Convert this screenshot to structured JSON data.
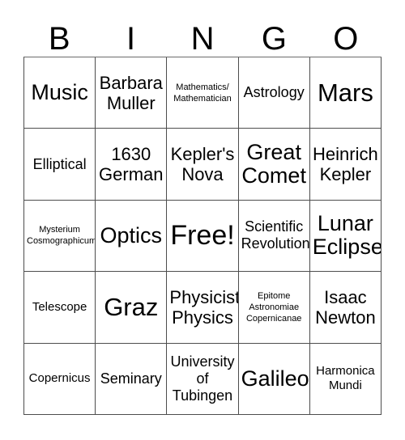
{
  "card": {
    "title_letters": [
      "B",
      "I",
      "N",
      "G",
      "O"
    ],
    "free_space_label": "Free!",
    "border_color": "#4d4d4d",
    "text_color": "#000000",
    "background_color": "#ffffff",
    "rows": [
      [
        {
          "text": "Music",
          "size": "l"
        },
        {
          "text": "Barbara\nMuller",
          "size": "m"
        },
        {
          "text": "Mathematics/\nMathematician",
          "size": "xxs"
        },
        {
          "text": "Astrology",
          "size": "s"
        },
        {
          "text": "Mars",
          "size": "xl"
        }
      ],
      [
        {
          "text": "Elliptical",
          "size": "s"
        },
        {
          "text": "1630\nGerman",
          "size": "m"
        },
        {
          "text": "Kepler's\nNova",
          "size": "m"
        },
        {
          "text": "Great\nComet",
          "size": "l"
        },
        {
          "text": "Heinrich\nKepler",
          "size": "m"
        }
      ],
      [
        {
          "text": "Mysterium\nCosmographicum",
          "size": "xxs"
        },
        {
          "text": "Optics",
          "size": "l"
        },
        {
          "text": "Free!",
          "size": "xxl"
        },
        {
          "text": "Scientific\nRevolution",
          "size": "s"
        },
        {
          "text": "Lunar\nEclipse",
          "size": "l"
        }
      ],
      [
        {
          "text": "Telescope",
          "size": "xs"
        },
        {
          "text": "Graz",
          "size": "xl"
        },
        {
          "text": "Physicist/\nPhysics",
          "size": "m"
        },
        {
          "text": "Epitome\nAstronomiae\nCopernicanae",
          "size": "xxs"
        },
        {
          "text": "Isaac\nNewton",
          "size": "m"
        }
      ],
      [
        {
          "text": "Copernicus",
          "size": "xs"
        },
        {
          "text": "Seminary",
          "size": "s"
        },
        {
          "text": "University\nof\nTubingen",
          "size": "s"
        },
        {
          "text": "Galileo",
          "size": "l"
        },
        {
          "text": "Harmonica\nMundi",
          "size": "xs"
        }
      ]
    ]
  }
}
